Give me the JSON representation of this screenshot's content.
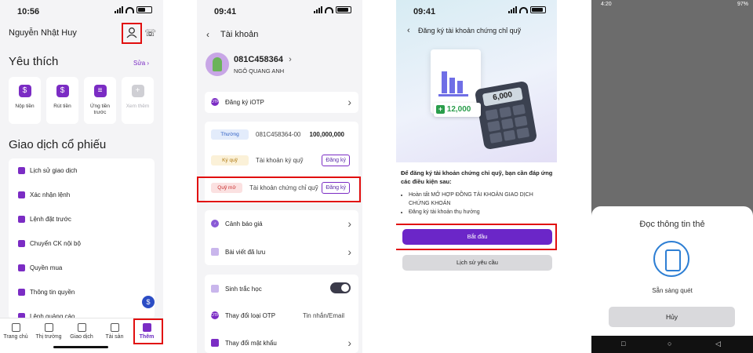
{
  "screen1": {
    "time": "10:56",
    "user_name": "Nguyễn Nhật Huy",
    "favorites_title": "Yêu thích",
    "edit_link": "Sửa",
    "tiles": [
      {
        "label": "Nộp tiền",
        "icon": "deposit-icon"
      },
      {
        "label": "Rút tiền",
        "icon": "withdraw-icon"
      },
      {
        "label": "Ứng tiền trước",
        "icon": "advance-icon"
      },
      {
        "label": "Xem thêm",
        "icon": "more-icon"
      }
    ],
    "section_title": "Giao dịch cổ phiếu",
    "menu": [
      "Lịch sử giao dịch",
      "Xác nhận lệnh",
      "Lệnh đặt trước",
      "Chuyển CK nội bộ",
      "Quyền mua",
      "Thông tin quyền",
      "Lệnh quảng cáo"
    ],
    "tabs": [
      "Trang chủ",
      "Thị trường",
      "Giao dịch",
      "Tài sản",
      "Thêm"
    ],
    "active_tab": "Thêm"
  },
  "screen2": {
    "time": "09:41",
    "title": "Tài khoản",
    "account_no": "081C458364",
    "owner": "NGÔ QUANG ANH",
    "iotp_label": "Đăng ký iOTP",
    "otp_badge": "OTP",
    "accounts": [
      {
        "tag": "Thường",
        "name": "081C458364-00",
        "value": "100,000,000"
      },
      {
        "tag": "Ký quỹ",
        "name": "Tài khoản ký quỹ",
        "action": "Đăng ký"
      },
      {
        "tag": "Quỹ mở",
        "name": "Tài khoản chứng chỉ quỹ",
        "action": "Đăng ký"
      }
    ],
    "price_alert": "Cảnh báo giá",
    "saved_posts": "Bài viết đã lưu",
    "biometric": "Sinh trắc học",
    "biometric_on": true,
    "change_otp": "Thay đổi loại OTP",
    "otp_type": "Tin nhắn/Email",
    "change_password": "Thay đổi mật khẩu"
  },
  "screen3": {
    "time": "09:41",
    "title": "Đăng ký tài khoản chứng chỉ quỹ",
    "calc_value": "6,000",
    "money_value": "12,000",
    "intro": "Để đăng ký tài khoản chứng chỉ quỹ, bạn cần đáp ứng các điều kiện sau:",
    "conditions": [
      "Hoàn tất MỞ HỢP ĐỒNG TÀI KHOẢN GIAO DỊCH CHỨNG KHOÁN",
      "Đăng ký tài khoản thụ hưởng"
    ],
    "start_button": "Bắt đầu",
    "history_button": "Lịch sử yêu cầu"
  },
  "screen4": {
    "time": "4:20",
    "battery": "97%",
    "title": "Đọc thông tin thẻ",
    "status": "Sẵn sàng quét",
    "cancel_button": "Hủy"
  }
}
